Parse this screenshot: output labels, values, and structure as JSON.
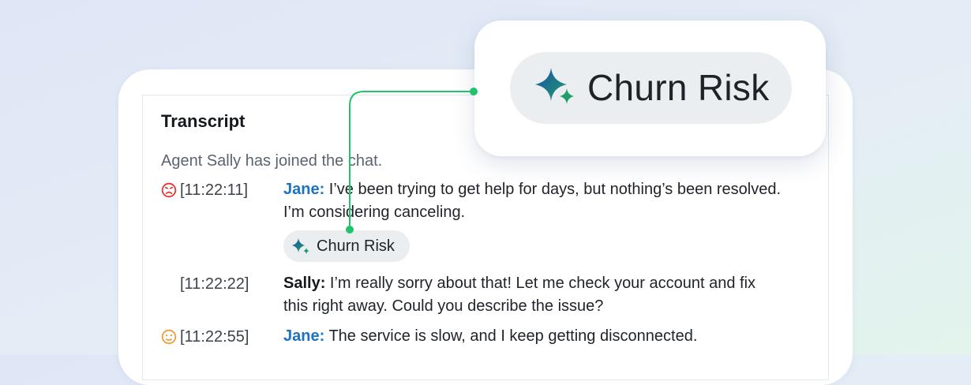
{
  "transcript": {
    "title": "Transcript",
    "system_message": "Agent Sally has joined the chat.",
    "messages": [
      {
        "timestamp": "[11:22:11]",
        "sentiment_icon": "frowning-face-icon",
        "sentiment_color": "#e53935",
        "speaker": "Jane:",
        "text_line1": " I’ve been trying to get help for days, but nothing’s been resolved.",
        "text_line2": "I’m considering canceling."
      },
      {
        "timestamp": "[11:22:22]",
        "speaker": "Sally:",
        "text_line1": " I’m really sorry about that! Let me check your account and fix",
        "text_line2": "this right away. Could you describe the issue?"
      },
      {
        "timestamp": "[11:22:55]",
        "sentiment_icon": "neutral-face-icon",
        "sentiment_color": "#f29b38",
        "speaker": "Jane:",
        "text_line1": " The service is slow, and I keep getting disconnected."
      }
    ],
    "tag_chip": {
      "label": "Churn Risk",
      "icon": "sparkle-icon"
    }
  },
  "callout": {
    "label": "Churn Risk",
    "icon": "sparkle-icon"
  },
  "colors": {
    "customer_name": "#1a73c4",
    "connector": "#1fc46a",
    "sparkle_blue": "#1a4fa8",
    "sparkle_green": "#1e9e6a"
  }
}
